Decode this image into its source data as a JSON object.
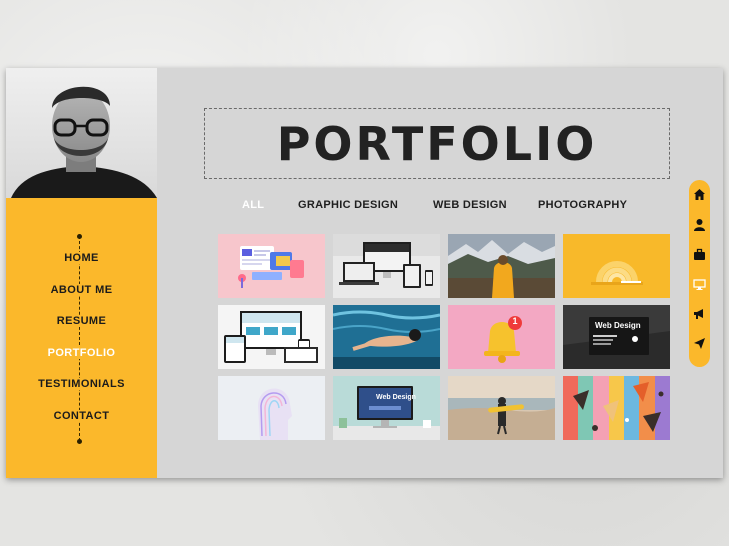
{
  "page": {
    "title": "PORTFOLIO"
  },
  "sidebar": {
    "avatar_alt": "profile photo",
    "nav": [
      {
        "label": "HOME"
      },
      {
        "label": "ABOUT ME"
      },
      {
        "label": "RESUME"
      },
      {
        "label": "PORTFOLIO",
        "active": true
      },
      {
        "label": "TESTIMONIALS"
      },
      {
        "label": "CONTACT"
      }
    ]
  },
  "filters": [
    {
      "label": "ALL",
      "active": true
    },
    {
      "label": "GRAPHIC DESIGN"
    },
    {
      "label": "WEB DESIGN"
    },
    {
      "label": "PHOTOGRAPHY"
    }
  ],
  "gallery": [
    {
      "subject": "isometric app illustration",
      "bg": "#f7c6cc"
    },
    {
      "subject": "responsive devices mockup",
      "bg": "#ededed"
    },
    {
      "subject": "hiker in yellow jacket mountains",
      "bg": "#8a8f96"
    },
    {
      "subject": "yellow 3d arches",
      "bg": "#f8b92a"
    },
    {
      "subject": "multi device website mockup",
      "bg": "#f5f5f5"
    },
    {
      "subject": "swimmer underwater",
      "bg": "#2b7ea3"
    },
    {
      "subject": "notification bell",
      "bg": "#f3a8c3",
      "badge": "1"
    },
    {
      "subject": "web design dark mockup",
      "bg": "#2a2a2a",
      "caption": "Web Design"
    },
    {
      "subject": "3d head sculpture",
      "bg": "#eceff3"
    },
    {
      "subject": "desktop web design mockup",
      "bg": "#b9dbd8",
      "caption": "Web Design"
    },
    {
      "subject": "surfer on beach",
      "bg": "#c9b7a3"
    },
    {
      "subject": "colorful 3d cones",
      "bg": "#f2b23a"
    }
  ],
  "social_icons": [
    "home-icon",
    "user-icon",
    "briefcase-icon",
    "monitor-icon",
    "megaphone-icon",
    "send-icon"
  ],
  "colors": {
    "accent": "#fbb82b",
    "panel": "#d6d6d6",
    "text": "#1b1b1b",
    "active": "#ffffff"
  }
}
